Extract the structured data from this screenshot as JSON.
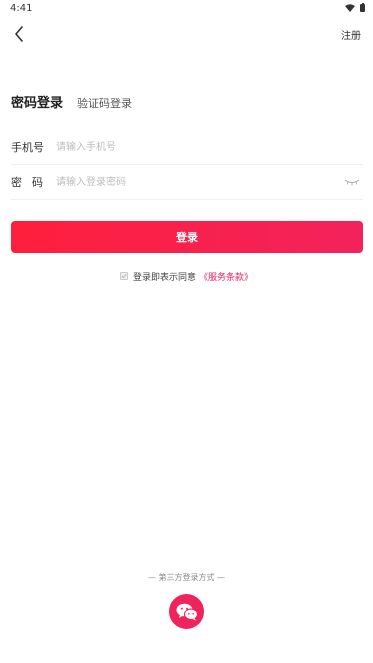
{
  "status_bar": {
    "time": "4:41"
  },
  "nav": {
    "register_label": "注册"
  },
  "tabs": {
    "password_login": "密码登录",
    "code_login": "验证码登录"
  },
  "form": {
    "phone_label": "手机号",
    "phone_placeholder": "请输入手机号",
    "password_label": "密码",
    "password_placeholder": "请输入登录密码"
  },
  "login_button_label": "登录",
  "agreement": {
    "text": "登录即表示同意",
    "terms_link": "《服务条款》"
  },
  "third_party": {
    "label": "— 第三方登录方式 —",
    "wechat_icon": "wechat-icon"
  },
  "colors": {
    "accent": "#f0245c",
    "button_start": "#ff1f3c",
    "button_end": "#f2225c"
  }
}
